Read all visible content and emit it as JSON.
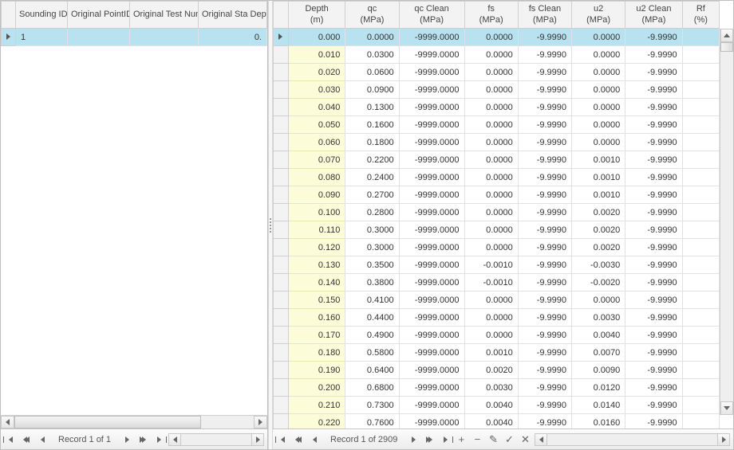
{
  "left": {
    "columns": [
      "Sounding ID",
      "Original PointID",
      "Original Test Number",
      "Original Start Depth (m)"
    ],
    "short_last": "Original Sta\nDepth...",
    "rows": [
      {
        "sounding_id": "1",
        "point_id": "",
        "test_no": "",
        "start_depth": "0."
      }
    ],
    "record_label": "Record 1 of 1"
  },
  "right": {
    "columns": [
      {
        "l1": "Depth",
        "l2": "(m)"
      },
      {
        "l1": "qc",
        "l2": "(MPa)"
      },
      {
        "l1": "qc Clean",
        "l2": "(MPa)"
      },
      {
        "l1": "fs",
        "l2": "(MPa)"
      },
      {
        "l1": "fs Clean",
        "l2": "(MPa)"
      },
      {
        "l1": "u2",
        "l2": "(MPa)"
      },
      {
        "l1": "u2 Clean",
        "l2": "(MPa)"
      },
      {
        "l1": "Rf",
        "l2": "(%)"
      }
    ],
    "rows": [
      {
        "depth": "0.000",
        "qc": "0.0000",
        "qcc": "-9999.0000",
        "fs": "0.0000",
        "fsc": "-9.9990",
        "u2": "0.0000",
        "u2c": "-9.9990",
        "rf": ""
      },
      {
        "depth": "0.010",
        "qc": "0.0300",
        "qcc": "-9999.0000",
        "fs": "0.0000",
        "fsc": "-9.9990",
        "u2": "0.0000",
        "u2c": "-9.9990",
        "rf": ""
      },
      {
        "depth": "0.020",
        "qc": "0.0600",
        "qcc": "-9999.0000",
        "fs": "0.0000",
        "fsc": "-9.9990",
        "u2": "0.0000",
        "u2c": "-9.9990",
        "rf": ""
      },
      {
        "depth": "0.030",
        "qc": "0.0900",
        "qcc": "-9999.0000",
        "fs": "0.0000",
        "fsc": "-9.9990",
        "u2": "0.0000",
        "u2c": "-9.9990",
        "rf": ""
      },
      {
        "depth": "0.040",
        "qc": "0.1300",
        "qcc": "-9999.0000",
        "fs": "0.0000",
        "fsc": "-9.9990",
        "u2": "0.0000",
        "u2c": "-9.9990",
        "rf": ""
      },
      {
        "depth": "0.050",
        "qc": "0.1600",
        "qcc": "-9999.0000",
        "fs": "0.0000",
        "fsc": "-9.9990",
        "u2": "0.0000",
        "u2c": "-9.9990",
        "rf": ""
      },
      {
        "depth": "0.060",
        "qc": "0.1800",
        "qcc": "-9999.0000",
        "fs": "0.0000",
        "fsc": "-9.9990",
        "u2": "0.0000",
        "u2c": "-9.9990",
        "rf": ""
      },
      {
        "depth": "0.070",
        "qc": "0.2200",
        "qcc": "-9999.0000",
        "fs": "0.0000",
        "fsc": "-9.9990",
        "u2": "0.0010",
        "u2c": "-9.9990",
        "rf": ""
      },
      {
        "depth": "0.080",
        "qc": "0.2400",
        "qcc": "-9999.0000",
        "fs": "0.0000",
        "fsc": "-9.9990",
        "u2": "0.0010",
        "u2c": "-9.9990",
        "rf": ""
      },
      {
        "depth": "0.090",
        "qc": "0.2700",
        "qcc": "-9999.0000",
        "fs": "0.0000",
        "fsc": "-9.9990",
        "u2": "0.0010",
        "u2c": "-9.9990",
        "rf": ""
      },
      {
        "depth": "0.100",
        "qc": "0.2800",
        "qcc": "-9999.0000",
        "fs": "0.0000",
        "fsc": "-9.9990",
        "u2": "0.0020",
        "u2c": "-9.9990",
        "rf": ""
      },
      {
        "depth": "0.110",
        "qc": "0.3000",
        "qcc": "-9999.0000",
        "fs": "0.0000",
        "fsc": "-9.9990",
        "u2": "0.0020",
        "u2c": "-9.9990",
        "rf": ""
      },
      {
        "depth": "0.120",
        "qc": "0.3000",
        "qcc": "-9999.0000",
        "fs": "0.0000",
        "fsc": "-9.9990",
        "u2": "0.0020",
        "u2c": "-9.9990",
        "rf": ""
      },
      {
        "depth": "0.130",
        "qc": "0.3500",
        "qcc": "-9999.0000",
        "fs": "-0.0010",
        "fsc": "-9.9990",
        "u2": "-0.0030",
        "u2c": "-9.9990",
        "rf": ""
      },
      {
        "depth": "0.140",
        "qc": "0.3800",
        "qcc": "-9999.0000",
        "fs": "-0.0010",
        "fsc": "-9.9990",
        "u2": "-0.0020",
        "u2c": "-9.9990",
        "rf": ""
      },
      {
        "depth": "0.150",
        "qc": "0.4100",
        "qcc": "-9999.0000",
        "fs": "0.0000",
        "fsc": "-9.9990",
        "u2": "0.0000",
        "u2c": "-9.9990",
        "rf": ""
      },
      {
        "depth": "0.160",
        "qc": "0.4400",
        "qcc": "-9999.0000",
        "fs": "0.0000",
        "fsc": "-9.9990",
        "u2": "0.0030",
        "u2c": "-9.9990",
        "rf": ""
      },
      {
        "depth": "0.170",
        "qc": "0.4900",
        "qcc": "-9999.0000",
        "fs": "0.0000",
        "fsc": "-9.9990",
        "u2": "0.0040",
        "u2c": "-9.9990",
        "rf": ""
      },
      {
        "depth": "0.180",
        "qc": "0.5800",
        "qcc": "-9999.0000",
        "fs": "0.0010",
        "fsc": "-9.9990",
        "u2": "0.0070",
        "u2c": "-9.9990",
        "rf": ""
      },
      {
        "depth": "0.190",
        "qc": "0.6400",
        "qcc": "-9999.0000",
        "fs": "0.0020",
        "fsc": "-9.9990",
        "u2": "0.0090",
        "u2c": "-9.9990",
        "rf": ""
      },
      {
        "depth": "0.200",
        "qc": "0.6800",
        "qcc": "-9999.0000",
        "fs": "0.0030",
        "fsc": "-9.9990",
        "u2": "0.0120",
        "u2c": "-9.9990",
        "rf": ""
      },
      {
        "depth": "0.210",
        "qc": "0.7300",
        "qcc": "-9999.0000",
        "fs": "0.0040",
        "fsc": "-9.9990",
        "u2": "0.0140",
        "u2c": "-9.9990",
        "rf": ""
      },
      {
        "depth": "0.220",
        "qc": "0.7600",
        "qcc": "-9999.0000",
        "fs": "0.0040",
        "fsc": "-9.9990",
        "u2": "0.0160",
        "u2c": "-9.9990",
        "rf": ""
      }
    ],
    "record_label": "Record 1 of 2909",
    "vthumb_height": 12
  },
  "nav_icons": {
    "plus": "+",
    "minus": "−",
    "edit": "✎",
    "check": "✓",
    "cancel": "✕"
  }
}
